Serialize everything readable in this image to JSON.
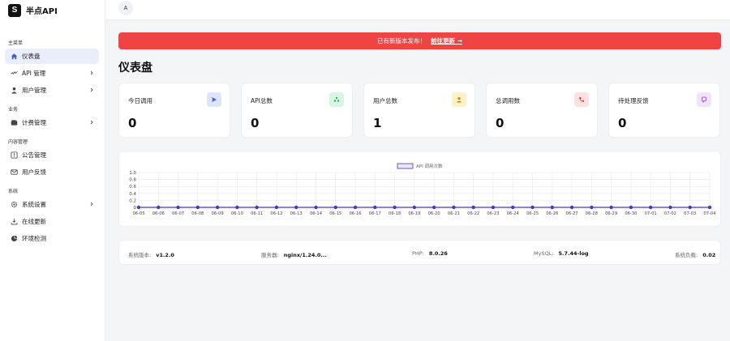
{
  "brand": {
    "logo_letter": "S",
    "name": "半点API"
  },
  "sidebar": {
    "sections": {
      "main": "主菜单",
      "business": "业务",
      "content": "内容管理",
      "system": "系统"
    },
    "items": [
      {
        "label": "仪表盘",
        "icon": "home-icon",
        "active": true
      },
      {
        "label": "API 管理",
        "icon": "api-icon",
        "chevron": true
      },
      {
        "label": "用户管理",
        "icon": "user-icon",
        "chevron": true
      },
      {
        "label": "计费管理",
        "icon": "wallet-icon",
        "chevron": true
      },
      {
        "label": "公告管理",
        "icon": "notice-icon"
      },
      {
        "label": "用户反馈",
        "icon": "mail-icon"
      },
      {
        "label": "系统设置",
        "icon": "gear-icon",
        "chevron": true
      },
      {
        "label": "在线更新",
        "icon": "download-icon"
      },
      {
        "label": "环境检测",
        "icon": "pie-icon"
      }
    ]
  },
  "topbar": {
    "avatar_letter": "A"
  },
  "banner": {
    "text": "已有新版本发布！",
    "link": "前往更新 →"
  },
  "page_title": "仪表盘",
  "stats": [
    {
      "label": "今日调用",
      "value": "0",
      "icon": "send-icon",
      "color": "#dde5fb",
      "icon_color": "#3b5bdb"
    },
    {
      "label": "API总数",
      "value": "0",
      "icon": "recycle-icon",
      "color": "#d6f5e3",
      "icon_color": "#16a34a"
    },
    {
      "label": "用户总数",
      "value": "1",
      "icon": "person-icon",
      "color": "#fdf1c7",
      "icon_color": "#ca8a04"
    },
    {
      "label": "总调用数",
      "value": "0",
      "icon": "phone-icon",
      "color": "#fde0e0",
      "icon_color": "#dc2626"
    },
    {
      "label": "待处理反馈",
      "value": "0",
      "icon": "chat-icon",
      "color": "#f1e3fb",
      "icon_color": "#9333ea"
    }
  ],
  "chart_data": {
    "type": "line",
    "legend": "API 调用次数",
    "legend_position": "top-center",
    "categories": [
      "06-05",
      "06-06",
      "06-07",
      "06-08",
      "06-09",
      "06-10",
      "06-11",
      "06-12",
      "06-13",
      "06-14",
      "06-15",
      "06-16",
      "06-17",
      "06-18",
      "06-19",
      "06-20",
      "06-21",
      "06-22",
      "06-23",
      "06-24",
      "06-25",
      "06-26",
      "06-27",
      "06-28",
      "06-29",
      "06-30",
      "07-01",
      "07-02",
      "07-03",
      "07-04"
    ],
    "series": [
      {
        "name": "API 调用次数",
        "values": [
          0,
          0,
          0,
          0,
          0,
          0,
          0,
          0,
          0,
          0,
          0,
          0,
          0,
          0,
          0,
          0,
          0,
          0,
          0,
          0,
          0,
          0,
          0,
          0,
          0,
          0,
          0,
          0,
          0,
          0
        ]
      }
    ],
    "y_ticks": [
      "1.0",
      "0.8",
      "0.6",
      "0.4",
      "0.2",
      "0"
    ],
    "ylim": [
      0,
      1
    ],
    "grid": true,
    "line_color": "#4338ca"
  },
  "info": [
    {
      "key": "系统版本:",
      "value": "v1.2.0"
    },
    {
      "key": "服务器:",
      "value": "nginx/1.24.0..."
    },
    {
      "key": "PHP:",
      "value": "8.0.26"
    },
    {
      "key": "MySQL:",
      "value": "5.7.44-log"
    },
    {
      "key": "系统负载:",
      "value": "0.02"
    }
  ]
}
